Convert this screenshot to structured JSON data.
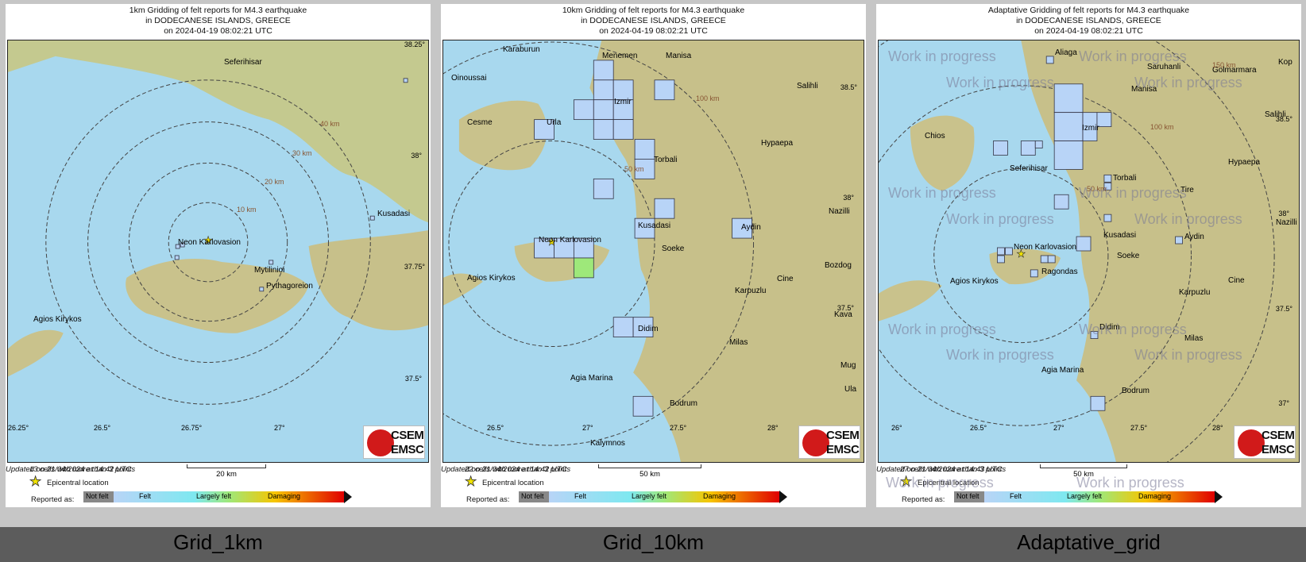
{
  "panels": [
    {
      "title_line1": "1km Gridding of felt reports for M4.3 earthquake",
      "title_line2": "in DODECANESE ISLANDS, GREECE",
      "title_line3": "on  2024-04-19 08:02:21 UTC",
      "cells_text": "13 cells with more than 3 points",
      "scale_label": "20 km",
      "updated_text": "Updated on 21/04/2024 at 14:42 UTC",
      "caption": "Grid_1km",
      "places": [
        "Seferihisar",
        "Neon Karlovasion",
        "Mytilinioi",
        "Pythagoreion",
        "Kusadasi",
        "Agios Kirykos"
      ],
      "rings": [
        "10 km",
        "20 km",
        "30 km",
        "40 km"
      ],
      "lon_ticks": [
        "26.25°",
        "26.5°",
        "26.75°",
        "27°"
      ],
      "lat_ticks": [
        "38.25°",
        "38°",
        "37.75°",
        "37.5°"
      ]
    },
    {
      "title_line1": "10km Gridding of felt reports for M4.3 earthquake",
      "title_line2": "in DODECANESE ISLANDS, GREECE",
      "title_line3": "on  2024-04-19 08:02:21 UTC",
      "cells_text": "22 cells with more than 3 points",
      "scale_label": "50 km",
      "updated_text": "Updated on 21/04/2024 at 14:42 UTC",
      "caption": "Grid_10km",
      "places": [
        "Karaburun",
        "Menemen",
        "Manisa",
        "Oinoussai",
        "Izmir",
        "Salihli",
        "Cesme",
        "Urla",
        "Torbali",
        "Hypaepa",
        "Kusadasi",
        "Aydin",
        "Nazilli",
        "Neon Karlovasion",
        "Soeke",
        "Agios Kirykos",
        "Karpuzlu",
        "Cine",
        "Bozdog",
        "Didim",
        "Milas",
        "Agia Marina",
        "Bodrum",
        "Kalymnos",
        "Kava",
        "Mug",
        "Ula"
      ],
      "rings": [
        "50 km",
        "100 km"
      ],
      "lon_ticks": [
        "26.5°",
        "27°",
        "27.5°",
        "28°"
      ],
      "lat_ticks": [
        "38.5°",
        "38°",
        "37.5°"
      ]
    },
    {
      "title_line1": "Adaptative Gridding of felt reports for M4.3 earthquake",
      "title_line2": "in DODECANESE ISLANDS, GREECE",
      "title_line3": "on  2024-04-19 08:02:21 UTC",
      "cells_text": "27 cells with more than 3 points",
      "scale_label": "50 km",
      "updated_text": "Updated on 21/04/2024 at 14:43 UTC",
      "caption": "Adaptative_grid",
      "places": [
        "Aliaga",
        "Saruhanli",
        "Golmarmara",
        "Manisa",
        "Kop",
        "Chios",
        "Izmir",
        "Salihli",
        "Seferihisar",
        "Torbali",
        "Hypaepa",
        "Tire",
        "Nazilli",
        "Kusadasi",
        "Aydin",
        "Neon Karlovasion",
        "Soeke",
        "Agios Kirykos",
        "Ragondas",
        "Cine",
        "Karpuzlu",
        "Didim",
        "Milas",
        "Agia Marina",
        "Bodrum"
      ],
      "rings": [
        "50 km",
        "100 km",
        "150 km"
      ],
      "lon_ticks": [
        "26°",
        "26.5°",
        "27°",
        "27.5°",
        "28°"
      ],
      "lat_ticks": [
        "38.5°",
        "38°",
        "37.5°",
        "37°"
      ],
      "watermark": "Work in progress"
    }
  ],
  "legend": {
    "epicentral": "Epicentral location",
    "reported_as": "Reported as:",
    "levels": [
      "Not felt",
      "Felt",
      "Largely felt",
      "Damaging"
    ]
  },
  "logo": {
    "line1": "CSEM",
    "line2": "EMSC"
  },
  "colors": {
    "sea": "#a8d8ee",
    "land": "#b9c98a",
    "felt_cell": "#b8d4f7",
    "strong_cell": "#9ee87a",
    "epicenter": "#f2e400"
  }
}
